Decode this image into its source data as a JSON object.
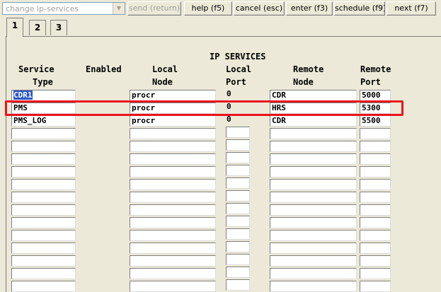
{
  "toolbar": {
    "command_value": "change ip-services",
    "buttons": {
      "send": "send (return)",
      "help": "help (f5)",
      "cancel": "cancel (esc)",
      "enter": "enter (f3)",
      "schedule": "schedule (f9)",
      "next": "next (f7)"
    }
  },
  "tabs": [
    "1",
    "2",
    "3"
  ],
  "form": {
    "title": "IP SERVICES",
    "headers": {
      "service_1": "Service",
      "service_2": "Type",
      "enabled": "Enabled",
      "local_node_1": "Local",
      "local_node_2": "Node",
      "local_port_1": "Local",
      "local_port_2": "Port",
      "remote_node_1": "Remote",
      "remote_node_2": "Node",
      "remote_port_1": "Remote",
      "remote_port_2": "Port"
    },
    "rows": [
      {
        "service_type": "CDR1",
        "local_node": "procr",
        "local_port": "0",
        "remote_node": "CDR",
        "remote_port": "5000"
      },
      {
        "service_type": "PMS",
        "local_node": "procr",
        "local_port": "0",
        "remote_node": "HRS",
        "remote_port": "5300"
      },
      {
        "service_type": "PMS_LOG",
        "local_node": "procr",
        "local_port": "0",
        "remote_node": "CDR",
        "remote_port": "5500"
      }
    ],
    "highlighted_row": "PMS",
    "highlight_color": "#e8141c",
    "selection_color": "#2b55c8"
  }
}
